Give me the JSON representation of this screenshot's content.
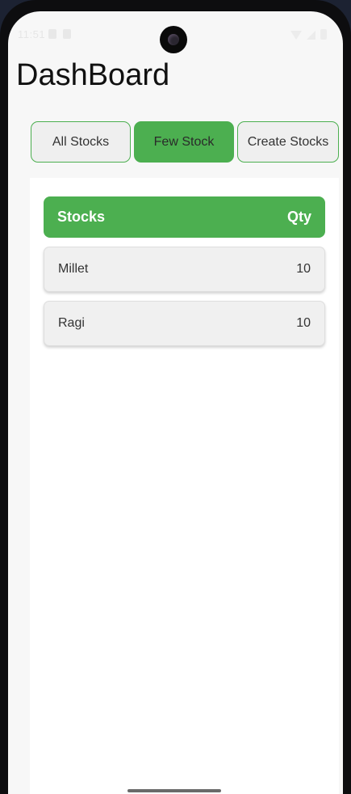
{
  "status_bar": {
    "time": "11:51"
  },
  "header": {
    "title": "DashBoard"
  },
  "tabs": [
    {
      "label": "All Stocks",
      "active": false
    },
    {
      "label": "Few Stock",
      "active": true
    },
    {
      "label": "Create Stocks",
      "active": false
    }
  ],
  "table": {
    "header": {
      "name": "Stocks",
      "qty": "Qty"
    },
    "rows": [
      {
        "name": "Millet",
        "qty": "10"
      },
      {
        "name": "Ragi",
        "qty": "10"
      }
    ]
  },
  "colors": {
    "accent": "#4caf50",
    "background": "#f7f7f7",
    "row_background": "#f0f0f0"
  }
}
